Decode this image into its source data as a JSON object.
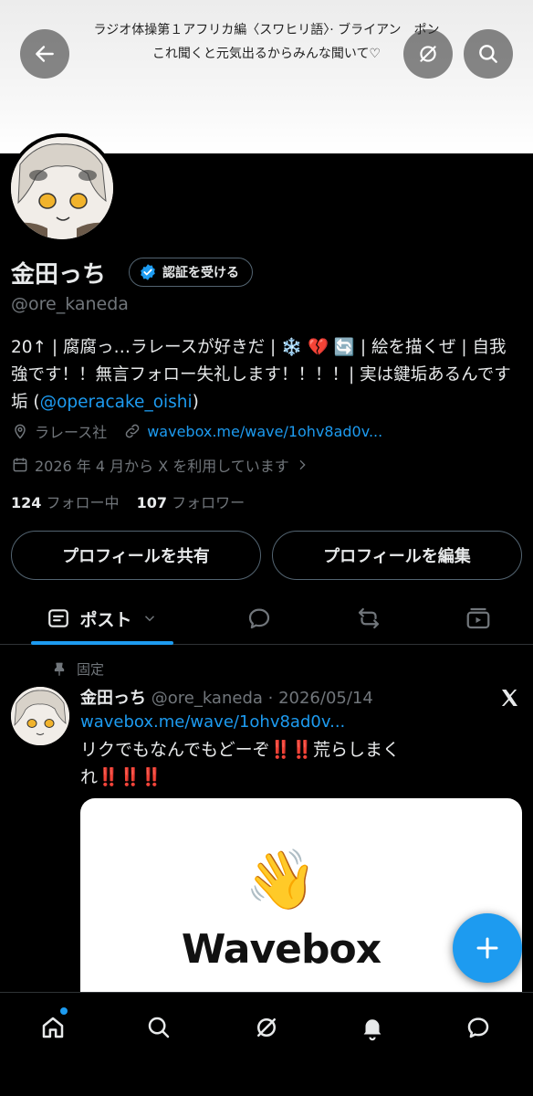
{
  "banner": {
    "line1": "ラジオ体操第１アフリカ編〈スワヒリ語〉· ブライアン　ポン",
    "line2": "これ聞くと元気出るからみんな聞いて♡"
  },
  "header": {
    "back_icon": "arrow-left-icon",
    "grok_icon": "grok-icon",
    "search_icon": "search-icon"
  },
  "profile": {
    "name": "金田っち",
    "verify_label": "認証を受ける",
    "handle": "@ore_kaneda",
    "bio_part1": "20↑ | 腐腐っ…ラレースが好きだ | ❄️ 💔 🔄 | 絵を描くぜ | 自我強です！！無言フォロー失礼します！！！！| 実は鍵垢あるんです垢 (",
    "bio_mention": "@operacake_oishi",
    "bio_part2": ")",
    "location": "ラレース社",
    "website": "wavebox.me/wave/1ohv8ad0v...",
    "joined": "2026 年 4 月から X を利用しています",
    "following_count": "124",
    "following_label": "フォロー中",
    "followers_count": "107",
    "followers_label": "フォロワー",
    "share_button": "プロフィールを共有",
    "edit_button": "プロフィールを編集"
  },
  "tabs": {
    "active_label": "ポスト"
  },
  "post": {
    "pinned_label": "固定",
    "author_name": "金田っち",
    "author_meta": "@ore_kaneda · 2026/05/14",
    "link": "wavebox.me/wave/1ohv8ad0v...",
    "text_part1": "リクでもなんでもどーぞ",
    "bang": "‼️",
    "text_part2": "荒らしまくれ",
    "card_title": "Wavebox",
    "card_emoji": "👋"
  },
  "colors": {
    "accent": "#1d9bf0",
    "background": "#000000",
    "muted": "#71767b"
  }
}
